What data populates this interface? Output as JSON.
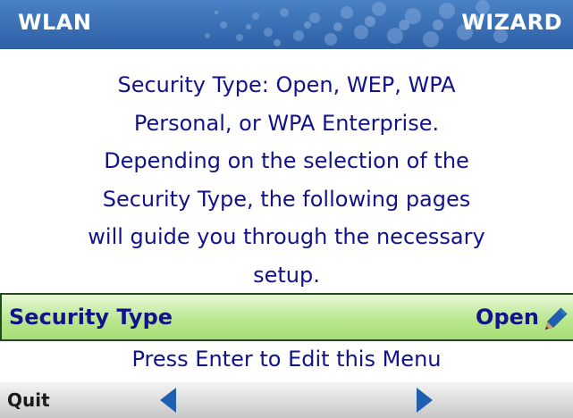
{
  "header": {
    "left_title": "WLAN",
    "right_title": "WIZARD"
  },
  "description": {
    "lines": [
      "Security Type: Open, WEP, WPA",
      "Personal, or WPA Enterprise.",
      "Depending on the selection of the",
      "Security Type, the following pages",
      "will guide you through the necessary",
      "setup."
    ]
  },
  "menu": {
    "label": "Security Type",
    "value": "Open",
    "icon": "pencil-icon",
    "highlight_color": "#b7e68a"
  },
  "hint": "Press Enter to Edit this Menu",
  "softkeys": {
    "quit_label": "Quit",
    "left_icon": "left-arrow-icon",
    "right_icon": "right-arrow-icon"
  },
  "colors": {
    "header": "#3a6fb4",
    "text": "#12128a",
    "arrow": "#1f5fb0"
  }
}
